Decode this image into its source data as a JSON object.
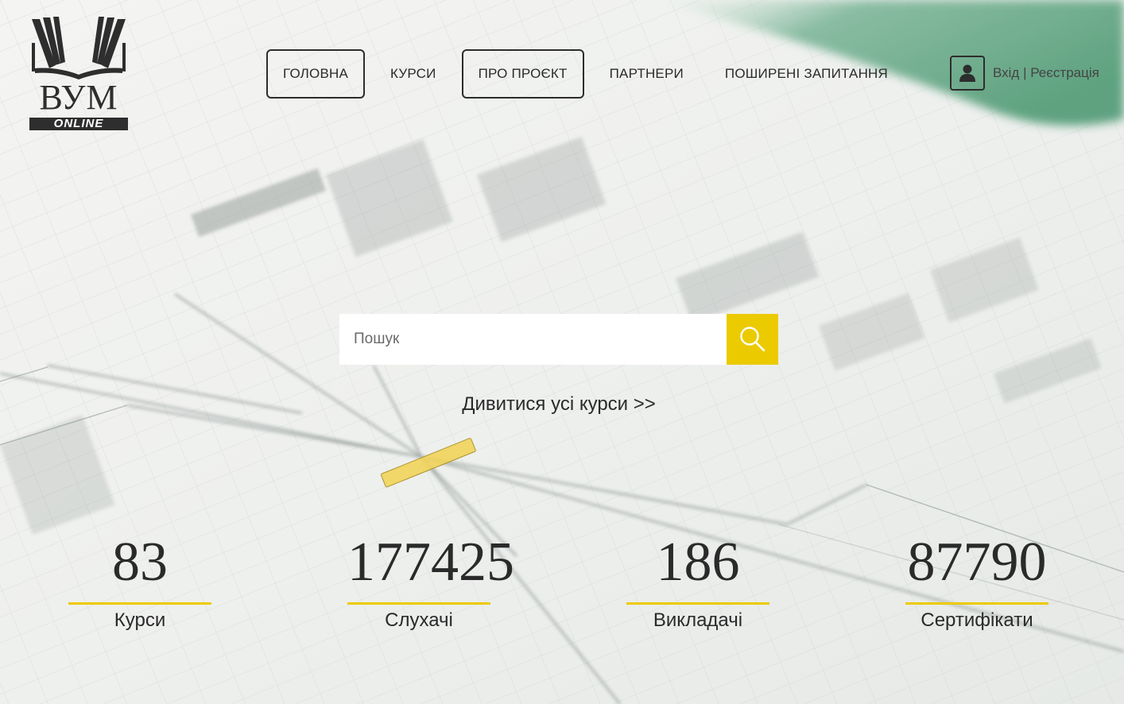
{
  "brand": {
    "name": "ВУМ",
    "sub": "ONLINE"
  },
  "nav": [
    {
      "label": "ГОЛОВНА",
      "boxed": true
    },
    {
      "label": "КУРСИ",
      "boxed": false
    },
    {
      "label": "ПРО ПРОЄКТ",
      "boxed": true
    },
    {
      "label": "ПАРТНЕРИ",
      "boxed": false
    },
    {
      "label": "ПОШИРЕНІ ЗАПИТАННЯ",
      "boxed": false
    }
  ],
  "auth": {
    "text": "Вхід | Реєстрація",
    "icon": "user-icon"
  },
  "search": {
    "placeholder": "Пошук",
    "value": "",
    "icon": "search-icon"
  },
  "all_courses_link": "Дивитися усі курси >>",
  "stats": [
    {
      "value": "83",
      "label": "Курси"
    },
    {
      "value": "177425",
      "label": "Слухачі"
    },
    {
      "value": "186",
      "label": "Викладачі"
    },
    {
      "value": "87790",
      "label": "Сертифікати"
    }
  ],
  "colors": {
    "accent": "#ecca00",
    "text": "#2a2a2a",
    "green": "#6aa98a"
  }
}
